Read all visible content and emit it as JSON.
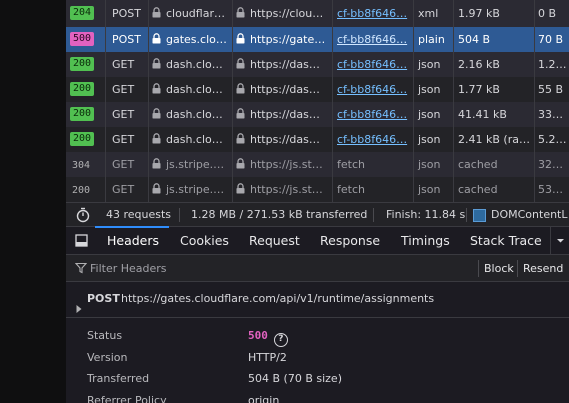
{
  "requests": [
    {
      "status": "204",
      "status_kind": "ok",
      "method": "POST",
      "domain": "cloudflar…",
      "file": "https://clou…",
      "initiator": "cf-bb8f646…",
      "type": "xml",
      "transferred": "1.97 kB",
      "size": "0 B",
      "row_style": "odd",
      "selected": false
    },
    {
      "status": "500",
      "status_kind": "err",
      "method": "POST",
      "domain": "gates.clo…",
      "file": "https://gate…",
      "initiator": "cf-bb8f646…",
      "type": "plain",
      "transferred": "504 B",
      "size": "70 B",
      "row_style": "selected",
      "selected": true
    },
    {
      "status": "200",
      "status_kind": "ok",
      "method": "GET",
      "domain": "dash.clo…",
      "file": "https://das…",
      "initiator": "cf-bb8f646…",
      "type": "json",
      "transferred": "2.16 kB",
      "size": "1.2…",
      "row_style": "odd",
      "selected": false
    },
    {
      "status": "200",
      "status_kind": "ok",
      "method": "GET",
      "domain": "dash.clo…",
      "file": "https://das…",
      "initiator": "cf-bb8f646…",
      "type": "json",
      "transferred": "1.77 kB",
      "size": "55 B",
      "row_style": "even",
      "selected": false
    },
    {
      "status": "200",
      "status_kind": "ok",
      "method": "GET",
      "domain": "dash.clo…",
      "file": "https://das…",
      "initiator": "cf-bb8f646…",
      "type": "json",
      "transferred": "41.41 kB",
      "size": "33…",
      "row_style": "odd",
      "selected": false
    },
    {
      "status": "200",
      "status_kind": "ok",
      "method": "GET",
      "domain": "dash.clo…",
      "file": "https://das…",
      "initiator": "cf-bb8f646…",
      "type": "json",
      "transferred": "2.41 kB (ra…",
      "size": "5.2…",
      "row_style": "even",
      "selected": false
    },
    {
      "status": "304",
      "status_kind": "plain",
      "method": "GET",
      "domain": "js.stripe.…",
      "file": "https://js.st…",
      "initiator": "fetch",
      "type": "json",
      "transferred": "cached",
      "size": "32…",
      "row_style": "odd",
      "selected": false
    },
    {
      "status": "200",
      "status_kind": "plain",
      "method": "GET",
      "domain": "js.stripe.…",
      "file": "https://js.st…",
      "initiator": "fetch",
      "type": "json",
      "transferred": "cached",
      "size": "53…",
      "row_style": "even",
      "selected": false
    }
  ],
  "summary": {
    "requests": "43 requests",
    "transferred": "1.28 MB / 271.53 kB transferred",
    "finish": "Finish: 11.84 s",
    "dom_content_loaded": "DOMContentL"
  },
  "tabs": [
    {
      "label": "Headers",
      "active": true
    },
    {
      "label": "Cookies",
      "active": false
    },
    {
      "label": "Request",
      "active": false
    },
    {
      "label": "Response",
      "active": false
    },
    {
      "label": "Timings",
      "active": false
    },
    {
      "label": "Stack Trace",
      "active": false
    }
  ],
  "filter": {
    "placeholder": "Filter Headers",
    "block_label": "Block",
    "resend_label": "Resend"
  },
  "request_line": {
    "method": "POST",
    "url": "https://gates.cloudflare.com/api/v1/runtime/assignments"
  },
  "details": {
    "status_label": "Status",
    "status_value": "500",
    "version_label": "Version",
    "version_value": "HTTP/2",
    "transferred_label": "Transferred",
    "transferred_value": "504 B (70 B size)",
    "referrer_label": "Referrer Policy",
    "referrer_value": "origin"
  },
  "colors": {
    "accent": "#2f8dfb",
    "selected_row": "#2e5a94",
    "status_ok": "#51c051",
    "status_error": "#e262c0"
  }
}
